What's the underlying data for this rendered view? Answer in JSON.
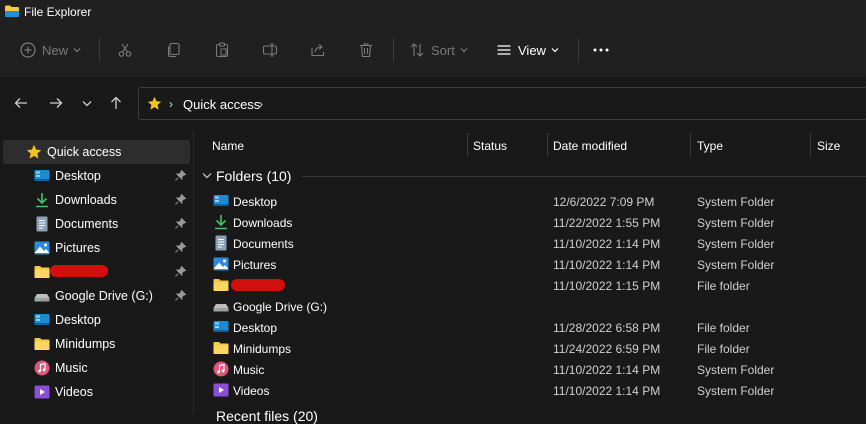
{
  "window": {
    "title": "File Explorer"
  },
  "toolbar": {
    "new_label": "New",
    "sort_label": "Sort",
    "view_label": "View"
  },
  "address": {
    "crumb": "Quick access"
  },
  "sidebar": {
    "items": [
      {
        "label": "Quick access",
        "icon": "star-icon",
        "pinned": false,
        "selected": true
      },
      {
        "label": "Desktop",
        "icon": "desktop-icon",
        "pinned": true
      },
      {
        "label": "Downloads",
        "icon": "download-icon",
        "pinned": true
      },
      {
        "label": "Documents",
        "icon": "documents-icon",
        "pinned": true
      },
      {
        "label": "Pictures",
        "icon": "pictures-icon",
        "pinned": true
      },
      {
        "label": "",
        "icon": "folder-icon",
        "pinned": true,
        "redacted": true
      },
      {
        "label": "Google Drive (G:)",
        "icon": "drive-icon",
        "pinned": true
      },
      {
        "label": "Desktop",
        "icon": "desktop-icon",
        "pinned": false
      },
      {
        "label": "Minidumps",
        "icon": "folder-icon",
        "pinned": false
      },
      {
        "label": "Music",
        "icon": "music-icon",
        "pinned": false
      },
      {
        "label": "Videos",
        "icon": "videos-icon",
        "pinned": false
      }
    ]
  },
  "columns": {
    "name": "Name",
    "status": "Status",
    "date": "Date modified",
    "type": "Type",
    "size": "Size"
  },
  "group": {
    "label": "Folders (10)",
    "recent_partial": "Recent files (20)"
  },
  "rows": [
    {
      "name": "Desktop",
      "icon": "desktop-icon",
      "date": "12/6/2022 7:09 PM",
      "type": "System Folder"
    },
    {
      "name": "Downloads",
      "icon": "download-icon",
      "date": "11/22/2022 1:55 PM",
      "type": "System Folder"
    },
    {
      "name": "Documents",
      "icon": "documents-icon",
      "date": "11/10/2022 1:14 PM",
      "type": "System Folder"
    },
    {
      "name": "Pictures",
      "icon": "pictures-icon",
      "date": "11/10/2022 1:14 PM",
      "type": "System Folder"
    },
    {
      "name": "",
      "icon": "folder-icon",
      "date": "11/10/2022 1:15 PM",
      "type": "File folder",
      "redacted": true
    },
    {
      "name": "Google Drive (G:)",
      "icon": "drive-icon",
      "date": "",
      "type": ""
    },
    {
      "name": "Desktop",
      "icon": "desktop-icon",
      "date": "11/28/2022 6:58 PM",
      "type": "File folder"
    },
    {
      "name": "Minidumps",
      "icon": "folder-icon",
      "date": "11/24/2022 6:59 PM",
      "type": "File folder"
    },
    {
      "name": "Music",
      "icon": "music-icon",
      "date": "11/10/2022 1:14 PM",
      "type": "System Folder"
    },
    {
      "name": "Videos",
      "icon": "videos-icon",
      "date": "11/10/2022 1:14 PM",
      "type": "System Folder"
    }
  ],
  "colors": {
    "background": "#191919",
    "toolbar": "#202020",
    "selection": "#2d2d2d",
    "folder": "#f6c945",
    "accent": "#1e90d6",
    "redaction": "#d10f0f"
  }
}
